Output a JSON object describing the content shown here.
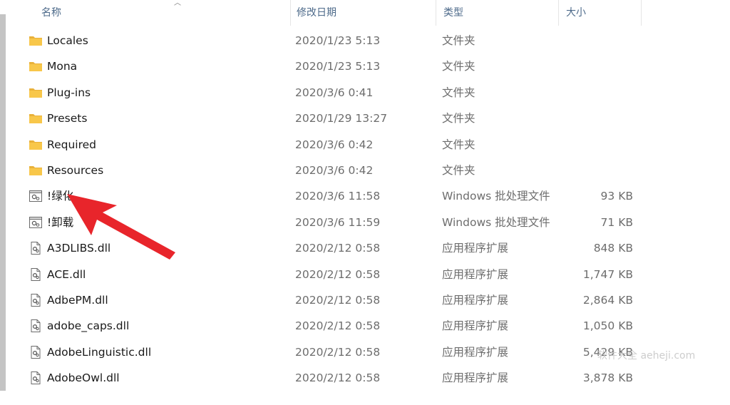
{
  "header": {
    "name": "名称",
    "date": "修改日期",
    "type": "类型",
    "size": "大小"
  },
  "rows": [
    {
      "icon": "folder-icon",
      "name": "Locales",
      "date": "2020/1/23 5:13",
      "type": "文件夹",
      "size": ""
    },
    {
      "icon": "folder-icon",
      "name": "Mona",
      "date": "2020/1/23 5:13",
      "type": "文件夹",
      "size": ""
    },
    {
      "icon": "folder-icon",
      "name": "Plug-ins",
      "date": "2020/3/6 0:41",
      "type": "文件夹",
      "size": ""
    },
    {
      "icon": "folder-icon",
      "name": "Presets",
      "date": "2020/1/29 13:27",
      "type": "文件夹",
      "size": ""
    },
    {
      "icon": "folder-icon",
      "name": "Required",
      "date": "2020/3/6 0:42",
      "type": "文件夹",
      "size": ""
    },
    {
      "icon": "folder-icon",
      "name": "Resources",
      "date": "2020/3/6 0:42",
      "type": "文件夹",
      "size": ""
    },
    {
      "icon": "batch-file-icon",
      "name": "!绿化",
      "date": "2020/3/6 11:58",
      "type": "Windows 批处理文件",
      "size": "93 KB"
    },
    {
      "icon": "batch-file-icon",
      "name": "!卸载",
      "date": "2020/3/6 11:59",
      "type": "Windows 批处理文件",
      "size": "71 KB"
    },
    {
      "icon": "dll-file-icon",
      "name": "A3DLIBS.dll",
      "date": "2020/2/12 0:58",
      "type": "应用程序扩展",
      "size": "848 KB"
    },
    {
      "icon": "dll-file-icon",
      "name": "ACE.dll",
      "date": "2020/2/12 0:58",
      "type": "应用程序扩展",
      "size": "1,747 KB"
    },
    {
      "icon": "dll-file-icon",
      "name": "AdbePM.dll",
      "date": "2020/2/12 0:58",
      "type": "应用程序扩展",
      "size": "2,864 KB"
    },
    {
      "icon": "dll-file-icon",
      "name": "adobe_caps.dll",
      "date": "2020/2/12 0:58",
      "type": "应用程序扩展",
      "size": "1,050 KB"
    },
    {
      "icon": "dll-file-icon",
      "name": "AdobeLinguistic.dll",
      "date": "2020/2/12 0:58",
      "type": "应用程序扩展",
      "size": "5,429 KB"
    },
    {
      "icon": "dll-file-icon",
      "name": "AdobeOwl.dll",
      "date": "2020/2/12 0:58",
      "type": "应用程序扩展",
      "size": "3,878 KB"
    }
  ],
  "watermark": "软件大全 aeheji.com",
  "colors": {
    "header_text": "#4d6a8a",
    "folder": "#f8c74a",
    "arrow": "#e8252b",
    "secondary_text": "#6d6d6d"
  }
}
